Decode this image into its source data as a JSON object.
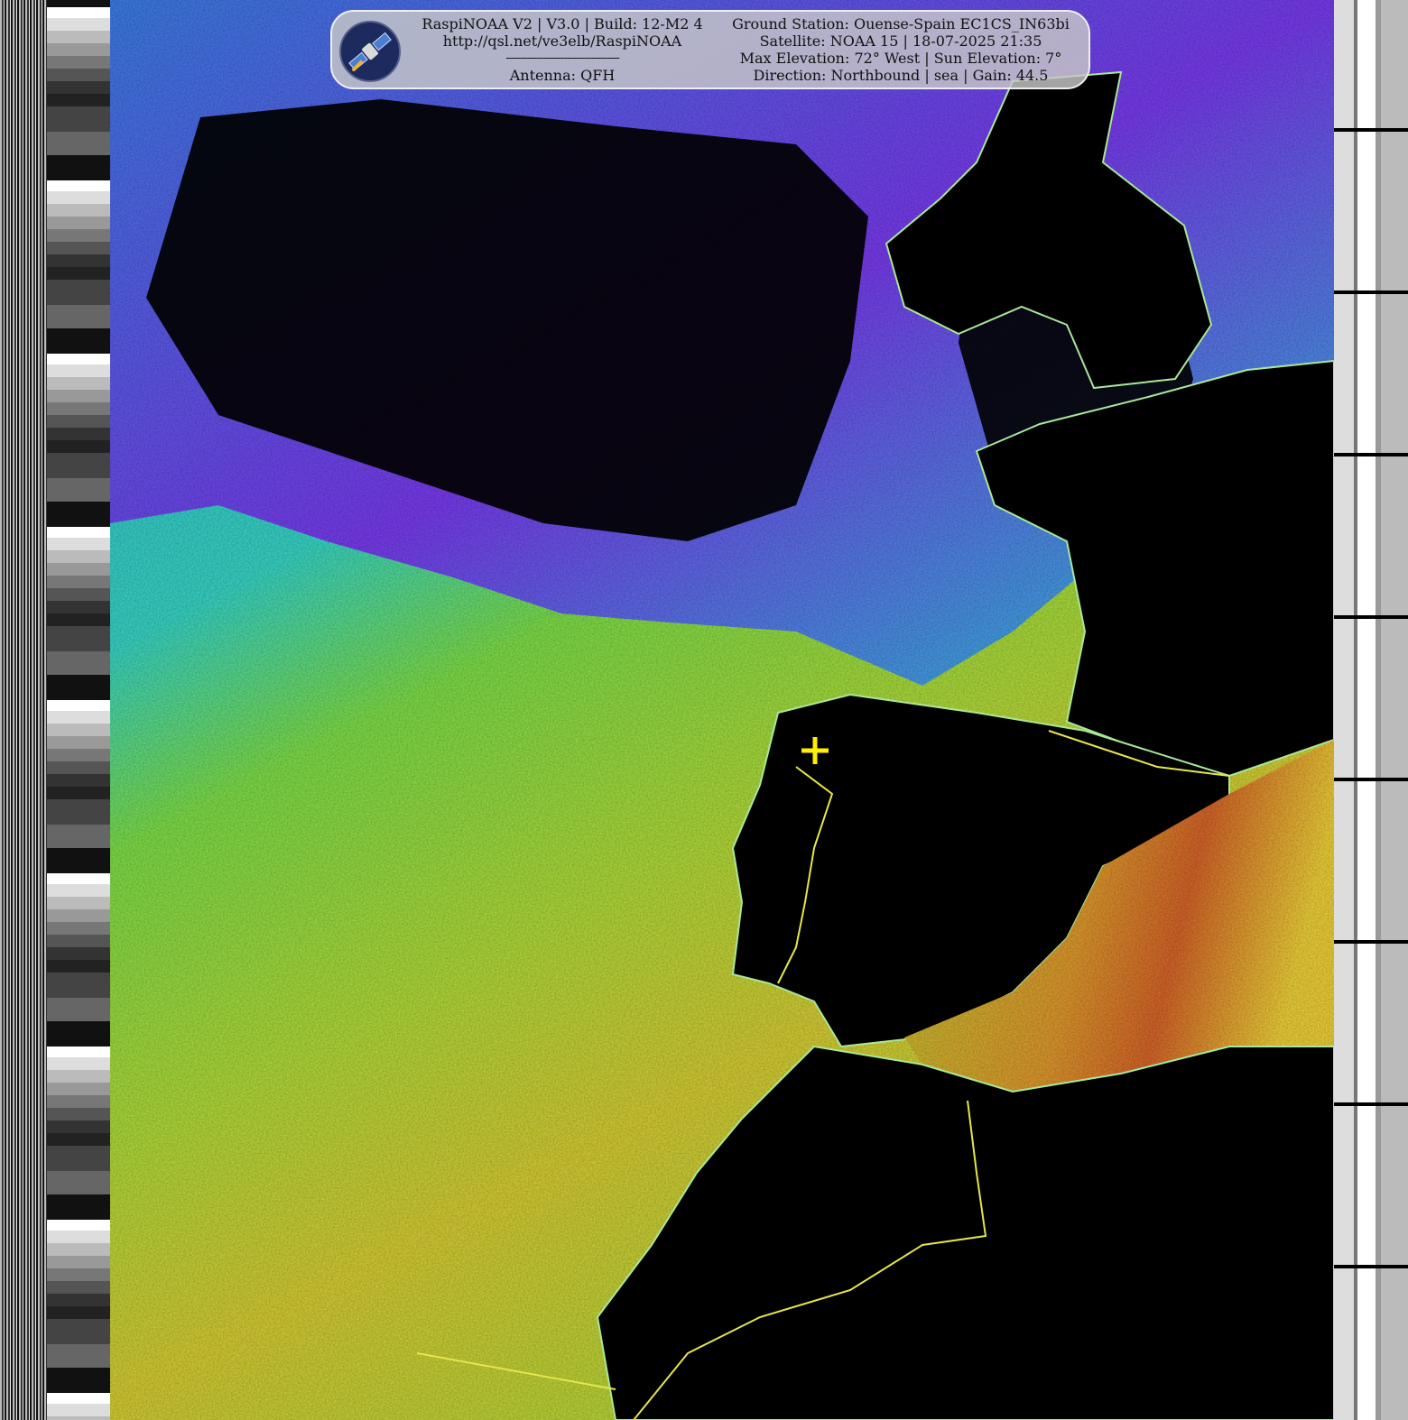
{
  "header": {
    "left": {
      "line1": "RaspiNOAA V2 | V3.0 | Build: 12-M2 4",
      "line2": "http://qsl.net/ve3elb/RaspiNOAA",
      "line3": "-------------------------------------",
      "line4": "Antenna: QFH"
    },
    "right": {
      "line1": "Ground Station: Ouense-Spain EC1CS_IN63bi",
      "line2": "Satellite: NOAA 15 | 18-07-2025 21:35",
      "line3": "Max Elevation: 72° West | Sun Elevation: 7°",
      "line4": "Direction: Northbound | sea | Gain: 44.5"
    },
    "logo_icon": "satellite-icon"
  },
  "colors": {
    "sea_cold": "#2ad5e0",
    "sea_mid": "#8fe63a",
    "sea_warm": "#e8d33a",
    "sea_hot": "#e0602a",
    "cloud": "#7b3cf0",
    "land": "#000000",
    "border_line": "#e6e64a",
    "coast_line": "#a8e89a",
    "station_marker": "#ffee00"
  }
}
